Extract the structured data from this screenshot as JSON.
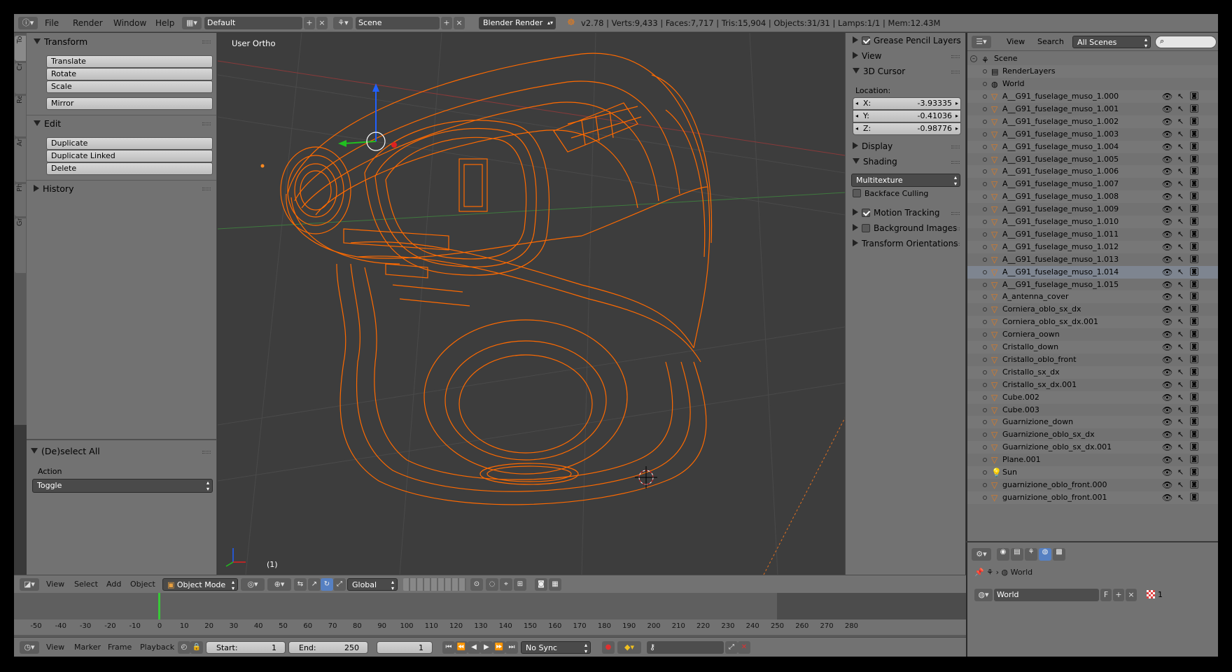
{
  "topbar": {
    "menus": [
      "File",
      "Render",
      "Window",
      "Help"
    ],
    "layout": "Default",
    "scene": "Scene",
    "engine": "Blender Render",
    "stats": "v2.78 | Verts:9,433 | Faces:7,717 | Tris:15,904 | Objects:31/31 | Lamps:1/1 | Mem:12.43M"
  },
  "tool_tabs": [
    "Tools",
    "Create",
    "Relations",
    "Animation",
    "Physics",
    "Grease Pencil"
  ],
  "toolshelf": {
    "transform": {
      "title": "Transform",
      "buttons": [
        "Translate",
        "Rotate",
        "Scale"
      ],
      "mirror": "Mirror"
    },
    "edit": {
      "title": "Edit",
      "buttons": [
        "Duplicate",
        "Duplicate Linked",
        "Delete"
      ]
    },
    "history": {
      "title": "History"
    },
    "operator": {
      "title": "(De)select All",
      "action_label": "Action",
      "action_value": "Toggle"
    }
  },
  "viewport": {
    "view_label": "User Ortho",
    "frame_label": "(1)"
  },
  "properties": {
    "grease_pencil": "Grease Pencil Layers",
    "view": "View",
    "cursor": {
      "title": "3D Cursor",
      "location_label": "Location:",
      "x_label": "X:",
      "x": "-3.93335",
      "y_label": "Y:",
      "y": "-0.41036",
      "z_label": "Z:",
      "z": "-0.98776"
    },
    "display": "Display",
    "shading": {
      "title": "Shading",
      "mode": "Multitexture",
      "backface": "Backface Culling"
    },
    "motion_tracking": "Motion Tracking",
    "background_images": "Background Images",
    "transform_orientations": "Transform Orientations"
  },
  "outliner": {
    "view": "View",
    "search": "Search",
    "filter": "All Scenes",
    "scene": "Scene",
    "render_layers": "RenderLayers",
    "world": "World",
    "objects": [
      "A__G91_fuselage_muso_1.000",
      "A__G91_fuselage_muso_1.001",
      "A__G91_fuselage_muso_1.002",
      "A__G91_fuselage_muso_1.003",
      "A__G91_fuselage_muso_1.004",
      "A__G91_fuselage_muso_1.005",
      "A__G91_fuselage_muso_1.006",
      "A__G91_fuselage_muso_1.007",
      "A__G91_fuselage_muso_1.008",
      "A__G91_fuselage_muso_1.009",
      "A__G91_fuselage_muso_1.010",
      "A__G91_fuselage_muso_1.011",
      "A__G91_fuselage_muso_1.012",
      "A__G91_fuselage_muso_1.013",
      "A__G91_fuselage_muso_1.014",
      "A__G91_fuselage_muso_1.015",
      "A_antenna_cover",
      "Corniera_oblo_sx_dx",
      "Corniera_oblo_sx_dx.001",
      "Corniera_oown",
      "Cristallo_down",
      "Cristallo_oblo_front",
      "Cristallo_sx_dx",
      "Cristallo_sx_dx.001",
      "Cube.002",
      "Cube.003",
      "Guarnizione_down",
      "Guarnizione_oblo_sx_dx",
      "Guarnizione_oblo_sx_dx.001",
      "Plane.001",
      "Sun",
      "guarnizione_oblo_front.000",
      "guarnizione_oblo_front.001"
    ],
    "selected_index": 14
  },
  "props_editor": {
    "context_path": "World",
    "world_name": "World",
    "fake_user": "F",
    "users": "1"
  },
  "view3d_header": {
    "menus": [
      "View",
      "Select",
      "Add",
      "Object"
    ],
    "mode": "Object Mode",
    "orientation": "Global"
  },
  "timeline": {
    "ticks": [
      "-50",
      "-40",
      "-30",
      "-20",
      "-10",
      "0",
      "10",
      "20",
      "30",
      "40",
      "50",
      "60",
      "70",
      "80",
      "90",
      "100",
      "110",
      "120",
      "130",
      "140",
      "150",
      "160",
      "170",
      "180",
      "190",
      "200",
      "210",
      "220",
      "230",
      "240",
      "250",
      "260",
      "270",
      "280"
    ],
    "menus": [
      "View",
      "Marker",
      "Frame",
      "Playback"
    ],
    "start_label": "Start:",
    "start": "1",
    "end_label": "End:",
    "end": "250",
    "current": "1",
    "sync": "No Sync"
  },
  "colors": {
    "wire": "#ff6a00",
    "selected_row": "#7e8590",
    "panel": "#727272",
    "viewport": "#3d3d3d"
  }
}
